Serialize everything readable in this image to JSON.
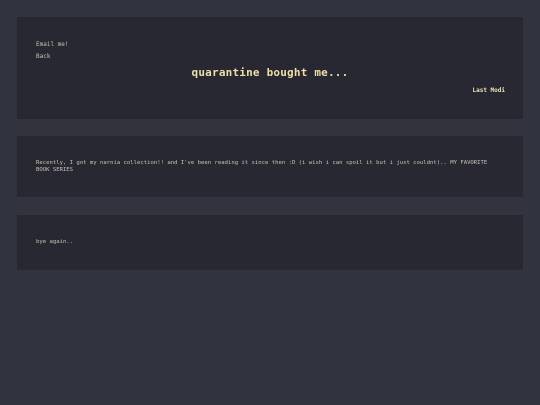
{
  "header": {
    "email_link": "Email me!",
    "back_link": "Back",
    "title": "quarantine bought me...",
    "last_modified": "Last Modi"
  },
  "post": {
    "body": "Recently, I got my narnia collection!! and I've been reading it since then :D (i wish i can spoil it but i just couldnt).. MY FAVORITE BOOK SERIES"
  },
  "footer": {
    "text": "bye again.."
  },
  "colors": {
    "page_background": "#31333f",
    "card_background": "#272831",
    "title_color": "#eedfa5",
    "text_color": "#c9c4b4"
  }
}
